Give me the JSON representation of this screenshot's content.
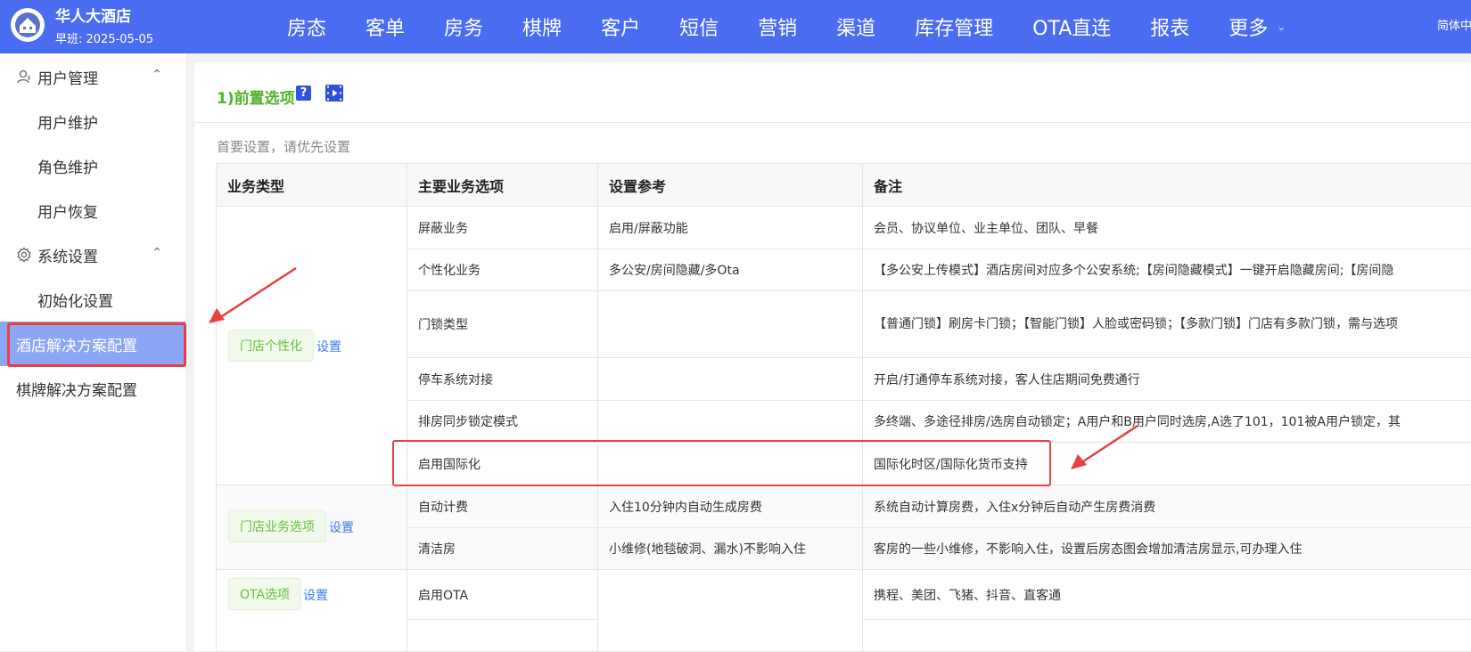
{
  "header": {
    "hotel_name": "华人大酒店",
    "shift": "早班: 2025-05-05",
    "nav": [
      "房态",
      "客单",
      "房务",
      "棋牌",
      "客户",
      "短信",
      "营销",
      "渠道",
      "库存管理",
      "OTA直连",
      "报表",
      "更多"
    ],
    "language": "简体中"
  },
  "sidebar": {
    "user_mgmt": "用户管理",
    "user_maint": "用户维护",
    "role_maint": "角色维护",
    "user_restore": "用户恢复",
    "sys_settings": "系统设置",
    "init_settings": "初始化设置",
    "hotel_solution": "酒店解决方案配置",
    "chess_solution": "棋牌解决方案配置"
  },
  "panel": {
    "title": "1)前置选项",
    "help": "?",
    "subtitle": "首要设置，请优先设置"
  },
  "table": {
    "headers": [
      "业务类型",
      "主要业务选项",
      "设置参考",
      "备注"
    ],
    "set_label": "设置",
    "groups": [
      {
        "tag": "门店个性化"
      },
      {
        "tag": "门店业务选项"
      },
      {
        "tag": "OTA选项"
      }
    ],
    "rows": [
      {
        "option": "屏蔽业务",
        "ref": "启用/屏蔽功能",
        "note": "会员、协议单位、业主单位、团队、早餐"
      },
      {
        "option": "个性化业务",
        "ref": "多公安/房间隐藏/多Ota",
        "note": "【多公安上传模式】酒店房间对应多个公安系统;【房间隐藏模式】一键开启隐藏房间;【房间隐"
      },
      {
        "option": "门锁类型",
        "ref": "",
        "note": "【普通门锁】刷房卡门锁；【智能门锁】人脸或密码锁；【多款门锁】门店有多款门锁，需与选项"
      },
      {
        "option": "停车系统对接",
        "ref": "",
        "note": "开启/打通停车系统对接，客人住店期间免费通行"
      },
      {
        "option": "排房同步锁定模式",
        "ref": "",
        "note": "多终端、多途径排房/选房自动锁定；A用户和B用户同时选房,A选了101，101被A用户锁定，其"
      },
      {
        "option": "启用国际化",
        "ref": "",
        "note": "国际化时区/国际化货币支持"
      },
      {
        "option": "自动计费",
        "ref": "入住10分钟内自动生成房费",
        "note": "系统自动计算房费，入住x分钟后自动产生房费消费"
      },
      {
        "option": "清洁房",
        "ref": "小维修(地毯破洞、漏水)不影响入住",
        "note": "客房的一些小维修，不影响入住，设置后房态图会增加清洁房显示,可办理入住"
      },
      {
        "option": "启用OTA",
        "ref": "",
        "note": "携程、美团、飞猪、抖音、直客通"
      }
    ]
  },
  "colors": {
    "topbar": "#4a6cf0",
    "active_menu": "#8aa6f5",
    "annotation": "#e84040",
    "title_green": "#52b22c",
    "tag_green": "#67c23a",
    "link_blue": "#3a7cf0"
  }
}
